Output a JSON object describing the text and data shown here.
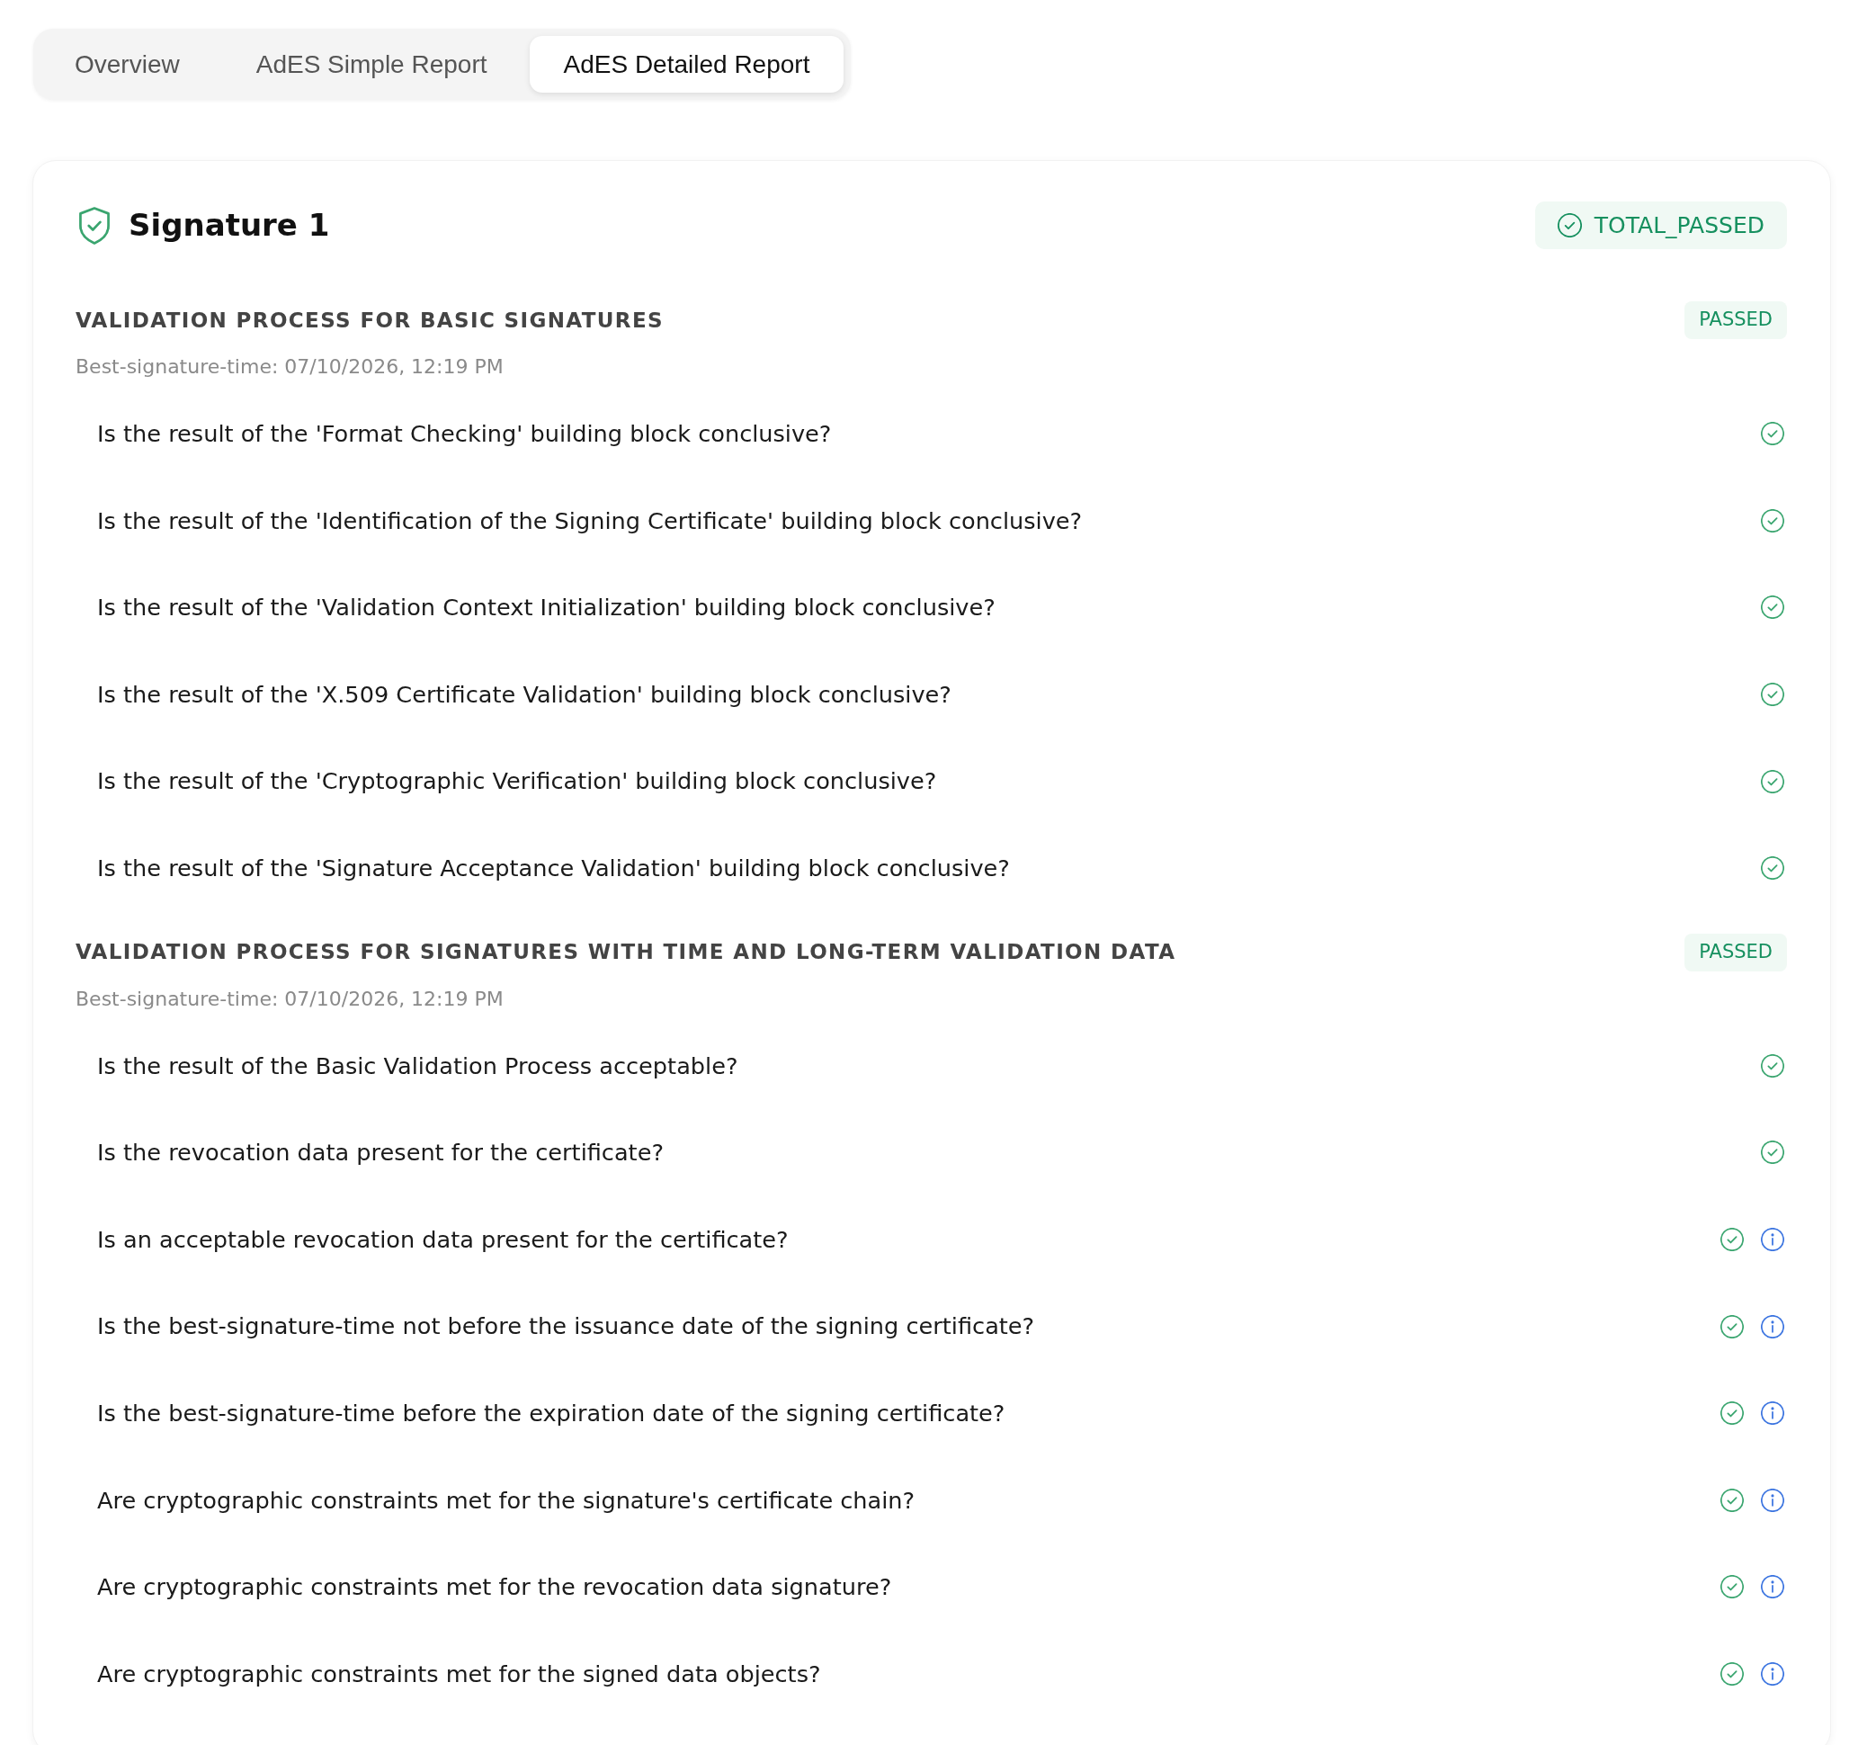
{
  "tabs": [
    {
      "label": "Overview",
      "selected": false
    },
    {
      "label": "AdES Simple Report",
      "selected": false
    },
    {
      "label": "AdES Detailed Report",
      "selected": true
    }
  ],
  "signature": {
    "title": "Signature 1",
    "status": "TOTAL_PASSED",
    "sections": [
      {
        "title": "VALIDATION PROCESS FOR BASIC SIGNATURES",
        "badge": "PASSED",
        "best_signature_time": "Best-signature-time: 07/10/2026, 12:19 PM",
        "checks": [
          {
            "question": "Is the result of the 'Format Checking' building block conclusive?",
            "passed": true,
            "info": false
          },
          {
            "question": "Is the result of the 'Identification of the Signing Certificate' building block conclusive?",
            "passed": true,
            "info": false
          },
          {
            "question": "Is the result of the 'Validation Context Initialization' building block conclusive?",
            "passed": true,
            "info": false
          },
          {
            "question": "Is the result of the 'X.509 Certificate Validation' building block conclusive?",
            "passed": true,
            "info": false
          },
          {
            "question": "Is the result of the 'Cryptographic Verification' building block conclusive?",
            "passed": true,
            "info": false
          },
          {
            "question": "Is the result of the 'Signature Acceptance Validation' building block conclusive?",
            "passed": true,
            "info": false
          }
        ]
      },
      {
        "title": "VALIDATION PROCESS FOR SIGNATURES WITH TIME AND LONG-TERM VALIDATION DATA",
        "badge": "PASSED",
        "best_signature_time": "Best-signature-time: 07/10/2026, 12:19 PM",
        "checks": [
          {
            "question": "Is the result of the Basic Validation Process acceptable?",
            "passed": true,
            "info": false
          },
          {
            "question": "Is the revocation data present for the certificate?",
            "passed": true,
            "info": false
          },
          {
            "question": "Is an acceptable revocation data present for the certificate?",
            "passed": true,
            "info": true
          },
          {
            "question": "Is the best-signature-time not before the issuance date of the signing certificate?",
            "passed": true,
            "info": true
          },
          {
            "question": "Is the best-signature-time before the expiration date of the signing certificate?",
            "passed": true,
            "info": true
          },
          {
            "question": "Are cryptographic constraints met for the signature's certificate chain?",
            "passed": true,
            "info": true
          },
          {
            "question": "Are cryptographic constraints met for the revocation data signature?",
            "passed": true,
            "info": true
          },
          {
            "question": "Are cryptographic constraints met for the signed data objects?",
            "passed": true,
            "info": true
          }
        ]
      }
    ]
  }
}
